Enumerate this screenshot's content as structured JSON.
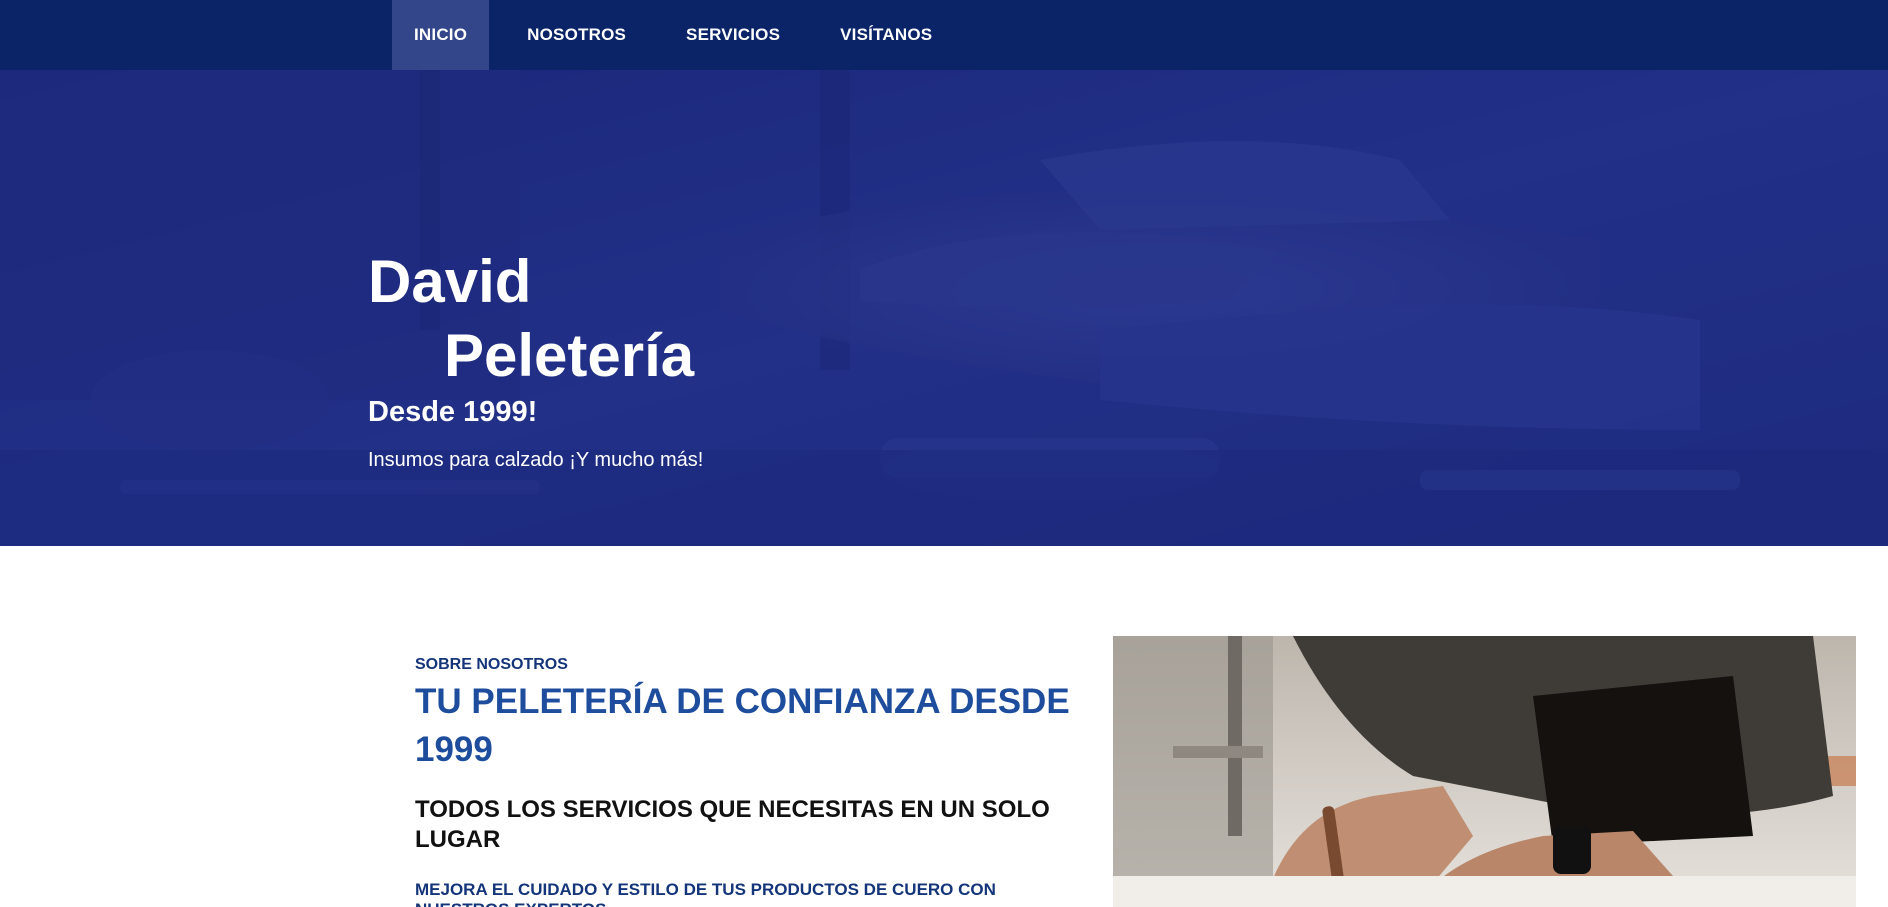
{
  "nav": {
    "items": [
      {
        "label": "INICIO",
        "active": true
      },
      {
        "label": "NOSOTROS",
        "active": false
      },
      {
        "label": "SERVICIOS",
        "active": false
      },
      {
        "label": "VISÍTANOS",
        "active": false
      }
    ]
  },
  "hero": {
    "title_line1": "David",
    "title_line2": "Peletería",
    "subtitle": "Desde 1999!",
    "tagline": "Insumos para calzado ¡Y mucho más!",
    "background": "hands-working-leather-photo",
    "overlay_color": "#1c2882"
  },
  "about": {
    "eyebrow": "SOBRE NOSOTROS",
    "title": "TU PELETERÍA DE CONFIANZA DESDE 1999",
    "subtitle": "TODOS LOS SERVICIOS QUE NECESITAS EN UN SOLO LUGAR",
    "lead": "MEJORA EL CUIDADO Y ESTILO DE TUS PRODUCTOS DE CUERO CON NUESTROS EXPERTOS",
    "photo": "craftsman-working-leather-photo"
  },
  "colors": {
    "nav_bg": "#0b2468",
    "nav_active": "#33468a",
    "accent_blue": "#1d4d9c",
    "dark_blue": "#14357a"
  }
}
